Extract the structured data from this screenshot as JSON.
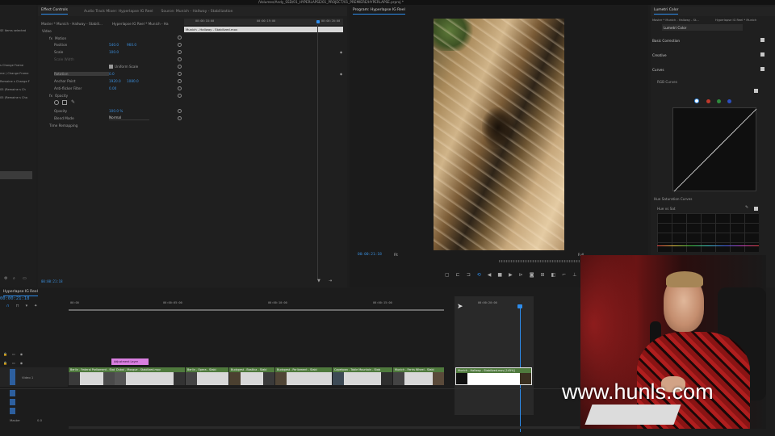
{
  "window": {
    "title": "/Volumes/Andy_SSD/01_HYPERLAPSE/01_PROJECT/01_PREMIERE/HYPERLAPSE.prproj *"
  },
  "left_strip": {
    "items": [
      "SE Items selected",
      "s Change Frame",
      "me ) Change Frame",
      "Remaine s Change F",
      "05 (Remaine s Ch",
      "05 (Remaine s Cha"
    ]
  },
  "effect_controls": {
    "tabs": [
      "Effect Controls",
      "Audio Track Mixer: Hyperlapse IG Reel",
      "Source: Munich - Hallway - Stabilization"
    ],
    "master_label": "Master * Munich - Hallway - Stabili...",
    "sequence_label": "Hyperlapse IG Reel * Munich - Ha",
    "section_video": "Video",
    "clip_name": "Munich - Hallway - Stabilized.mov",
    "timecode_ruler": [
      "00:00:18:00",
      "00:00:19:00",
      "00:00:20:00"
    ],
    "rows": [
      {
        "label": "Motion",
        "value": ""
      },
      {
        "label": "Position",
        "value": "540.0",
        "value2": "960.0"
      },
      {
        "label": "Scale",
        "value": "100.0",
        "value2": ""
      },
      {
        "label": "Scale Width",
        "value": "",
        "value2": ""
      },
      {
        "label": "Uniform Scale",
        "value": "",
        "value2": ""
      },
      {
        "label": "Rotation",
        "value": "0.0",
        "value2": ""
      },
      {
        "label": "Anchor Point",
        "value": "1920.0",
        "value2": "1080.0"
      },
      {
        "label": "Anti-flicker Filter",
        "value": "0.00",
        "value2": ""
      },
      {
        "label": "Opacity",
        "value": "",
        "value2": ""
      },
      {
        "label": "Opacity",
        "value": "100.0 %",
        "value2": ""
      },
      {
        "label": "Blend Mode",
        "value": "Normal",
        "value2": ""
      },
      {
        "label": "Time Remapping",
        "value": "",
        "value2": ""
      }
    ],
    "timecode": "00:00:21:18"
  },
  "program_monitor": {
    "tab": "Program: Hyperlapse IG Reel",
    "timecode": "00:00:21:18",
    "fit": "Fit",
    "full_label": "Full"
  },
  "lumetri": {
    "tab": "Lumetri Color",
    "master_label": "Master * Munich - Hallway - St...",
    "sequence_label": "Hyperlapse IG Reel * Munich",
    "preset": "Lumetri Color",
    "sections": [
      "Basic Correction",
      "Creative",
      "Curves"
    ],
    "rgb_curves": "RGB Curves",
    "hue_sat": "Hue Saturation Curves",
    "hue_vs_sat": "Hue vs Sat"
  },
  "timeline": {
    "tab": "Hyperlapse IG Reel",
    "timecode": "00:00:21:18",
    "ruler": [
      "00:00",
      "00:00:05:00",
      "00:00:10:00",
      "00:00:15:00",
      "00:00:20:00"
    ],
    "adjustment_layer": "Adjustment Layer",
    "track_label": "Video 1",
    "master_label": "Master",
    "master_value": "0.0",
    "clips": [
      "Berlin - Federal Parliament - Stabil",
      "Dubai - Mosque - Stabilized.mov",
      "Berlin - Opera - Stabi",
      "Budapest - Basilica - Stabi",
      "Budapest - Parliament - Stabi",
      "Capetown - Table Mountain - Stab",
      "Munich - Ferris Wheel - Stabi",
      "Munich - Hallway - Stabilized.mov [145%]"
    ]
  },
  "watermark": {
    "text": "www.hunls.com"
  },
  "colors": {
    "accent": "#2d8ceb",
    "clip_header": "#4f7a3d",
    "adjustment": "#d97fe0"
  }
}
